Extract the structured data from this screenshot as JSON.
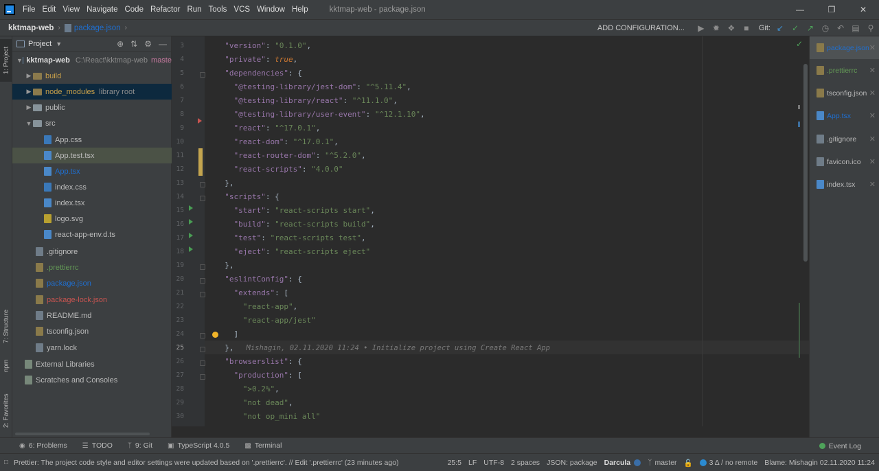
{
  "menu": {
    "items": [
      "File",
      "Edit",
      "View",
      "Navigate",
      "Code",
      "Refactor",
      "Run",
      "Tools",
      "VCS",
      "Window",
      "Help"
    ],
    "window_title": "kktmap-web - package.json"
  },
  "nav": {
    "project": "kktmap-web",
    "file": "package.json",
    "add_config": "ADD CONFIGURATION...",
    "git_label": "Git:"
  },
  "left_strip": {
    "project_tab": "1: Project",
    "structure_tab": "7: Structure",
    "npm_tab": "npm",
    "favorites_tab": "2: Favorites"
  },
  "project_panel": {
    "title": "Project",
    "root_name": "kktmap-web",
    "root_path": "C:\\React\\kktmap-web",
    "root_branch": "maste",
    "items": [
      {
        "name": "build",
        "type": "folder-excl"
      },
      {
        "name": "node_modules",
        "note": "library root",
        "type": "folder-excl"
      },
      {
        "name": "public",
        "type": "folder"
      },
      {
        "name": "src",
        "type": "folder"
      },
      {
        "name": "App.css",
        "type": "css"
      },
      {
        "name": "App.test.tsx",
        "type": "ts"
      },
      {
        "name": "App.tsx",
        "type": "ts"
      },
      {
        "name": "index.css",
        "type": "css"
      },
      {
        "name": "index.tsx",
        "type": "ts"
      },
      {
        "name": "logo.svg",
        "type": "svg"
      },
      {
        "name": "react-app-env.d.ts",
        "type": "ts"
      },
      {
        "name": ".gitignore",
        "type": "file"
      },
      {
        "name": ".prettierrc",
        "type": "json"
      },
      {
        "name": "package.json",
        "type": "json"
      },
      {
        "name": "package-lock.json",
        "type": "json"
      },
      {
        "name": "README.md",
        "type": "file"
      },
      {
        "name": "tsconfig.json",
        "type": "json"
      },
      {
        "name": "yarn.lock",
        "type": "file"
      }
    ],
    "external_libraries": "External Libraries",
    "scratches": "Scratches and Consoles"
  },
  "editor": {
    "line_numbers": [
      "3",
      "4",
      "5",
      "6",
      "7",
      "8",
      "9",
      "10",
      "11",
      "12",
      "13",
      "14",
      "15",
      "16",
      "17",
      "18",
      "19",
      "20",
      "21",
      "22",
      "23",
      "24",
      "25",
      "26",
      "27",
      "28",
      "29",
      "30"
    ],
    "blame": "Mishagin, 02.11.2020 11:24 • Initialize project using Create React App",
    "lines": [
      {
        "indent": "  ",
        "parts": [
          [
            "k",
            "\"version\""
          ],
          [
            "p",
            ": "
          ],
          [
            "s",
            "\"0.1.0\""
          ],
          [
            "p",
            ","
          ]
        ]
      },
      {
        "indent": "  ",
        "parts": [
          [
            "k",
            "\"private\""
          ],
          [
            "p",
            ": "
          ],
          [
            "b",
            "true"
          ],
          [
            "p",
            ","
          ]
        ]
      },
      {
        "indent": "  ",
        "parts": [
          [
            "k",
            "\"dependencies\""
          ],
          [
            "p",
            ": {"
          ]
        ]
      },
      {
        "indent": "    ",
        "parts": [
          [
            "k",
            "\"@testing-library/jest-dom\""
          ],
          [
            "p",
            ": "
          ],
          [
            "s",
            "\"^5.11.4\""
          ],
          [
            "p",
            ","
          ]
        ]
      },
      {
        "indent": "    ",
        "parts": [
          [
            "k",
            "\"@testing-library/react\""
          ],
          [
            "p",
            ": "
          ],
          [
            "s",
            "\"^11.1.0\""
          ],
          [
            "p",
            ","
          ]
        ]
      },
      {
        "indent": "    ",
        "parts": [
          [
            "k",
            "\"@testing-library/user-event\""
          ],
          [
            "p",
            ": "
          ],
          [
            "s",
            "\"^12.1.10\""
          ],
          [
            "p",
            ","
          ]
        ]
      },
      {
        "indent": "    ",
        "parts": [
          [
            "k",
            "\"react\""
          ],
          [
            "p",
            ": "
          ],
          [
            "s",
            "\"^17.0.1\""
          ],
          [
            "p",
            ","
          ]
        ]
      },
      {
        "indent": "    ",
        "parts": [
          [
            "k",
            "\"react-dom\""
          ],
          [
            "p",
            ": "
          ],
          [
            "s",
            "\"^17.0.1\""
          ],
          [
            "p",
            ","
          ]
        ]
      },
      {
        "indent": "    ",
        "parts": [
          [
            "k",
            "\"react-router-dom\""
          ],
          [
            "p",
            ": "
          ],
          [
            "s",
            "\"^5.2.0\""
          ],
          [
            "p",
            ","
          ]
        ]
      },
      {
        "indent": "    ",
        "parts": [
          [
            "k",
            "\"react-scripts\""
          ],
          [
            "p",
            ": "
          ],
          [
            "s",
            "\"4.0.0\""
          ]
        ]
      },
      {
        "indent": "  ",
        "parts": [
          [
            "p",
            "},"
          ]
        ]
      },
      {
        "indent": "  ",
        "parts": [
          [
            "k",
            "\"scripts\""
          ],
          [
            "p",
            ": {"
          ]
        ]
      },
      {
        "indent": "    ",
        "parts": [
          [
            "k",
            "\"start\""
          ],
          [
            "p",
            ": "
          ],
          [
            "s",
            "\"react-scripts start\""
          ],
          [
            "p",
            ","
          ]
        ]
      },
      {
        "indent": "    ",
        "parts": [
          [
            "k",
            "\"build\""
          ],
          [
            "p",
            ": "
          ],
          [
            "s",
            "\"react-scripts build\""
          ],
          [
            "p",
            ","
          ]
        ]
      },
      {
        "indent": "    ",
        "parts": [
          [
            "k",
            "\"test\""
          ],
          [
            "p",
            ": "
          ],
          [
            "s",
            "\"react-scripts test\""
          ],
          [
            "p",
            ","
          ]
        ]
      },
      {
        "indent": "    ",
        "parts": [
          [
            "k",
            "\"eject\""
          ],
          [
            "p",
            ": "
          ],
          [
            "s",
            "\"react-scripts eject\""
          ]
        ]
      },
      {
        "indent": "  ",
        "parts": [
          [
            "p",
            "},"
          ]
        ]
      },
      {
        "indent": "  ",
        "parts": [
          [
            "k",
            "\"eslintConfig\""
          ],
          [
            "p",
            ": {"
          ]
        ]
      },
      {
        "indent": "    ",
        "parts": [
          [
            "k",
            "\"extends\""
          ],
          [
            "p",
            ": ["
          ]
        ]
      },
      {
        "indent": "      ",
        "parts": [
          [
            "s",
            "\"react-app\""
          ],
          [
            "p",
            ","
          ]
        ]
      },
      {
        "indent": "      ",
        "parts": [
          [
            "s",
            "\"react-app/jest\""
          ]
        ]
      },
      {
        "indent": "    ",
        "parts": [
          [
            "p",
            "]"
          ]
        ]
      },
      {
        "indent": "  ",
        "parts": [
          [
            "p",
            "},"
          ]
        ]
      },
      {
        "indent": "  ",
        "parts": [
          [
            "k",
            "\"browserslist\""
          ],
          [
            "p",
            ": {"
          ]
        ]
      },
      {
        "indent": "    ",
        "parts": [
          [
            "k",
            "\"production\""
          ],
          [
            "p",
            ": ["
          ]
        ]
      },
      {
        "indent": "      ",
        "parts": [
          [
            "s",
            "\">0.2%\""
          ],
          [
            "p",
            ","
          ]
        ]
      },
      {
        "indent": "      ",
        "parts": [
          [
            "s",
            "\"not dead\""
          ],
          [
            "p",
            ","
          ]
        ]
      },
      {
        "indent": "      ",
        "parts": [
          [
            "s",
            "\"not op_mini all\""
          ]
        ]
      }
    ]
  },
  "right_tabs": [
    {
      "name": "package.json",
      "color": "#1f6fd0",
      "active": true
    },
    {
      "name": ".prettierrc",
      "color": "#629755",
      "active": false
    },
    {
      "name": "tsconfig.json",
      "color": "#bbbbbb",
      "active": false
    },
    {
      "name": "App.tsx",
      "color": "#1f6fd0",
      "active": false
    },
    {
      "name": ".gitignore",
      "color": "#bbbbbb",
      "active": false
    },
    {
      "name": "favicon.ico",
      "color": "#bbbbbb",
      "active": false
    },
    {
      "name": "index.tsx",
      "color": "#bbbbbb",
      "active": false
    }
  ],
  "bottom_tools": {
    "problems": "6: Problems",
    "todo": "TODO",
    "git": "9: Git",
    "typescript": "TypeScript 4.0.5",
    "terminal": "Terminal",
    "event_log": "Event Log"
  },
  "status": {
    "message": "Prettier: The project code style and editor settings were updated based on '.prettierrc'. // Edit '.prettierrc' (23 minutes ago)",
    "position": "25:5",
    "line_sep": "LF",
    "encoding": "UTF-8",
    "indent": "2 spaces",
    "schema": "JSON: package",
    "theme": "Darcula",
    "branch": "master",
    "remote": "3 Δ / no remote",
    "blame": "Blame: Mishagin 02.11.2020 11:24"
  }
}
